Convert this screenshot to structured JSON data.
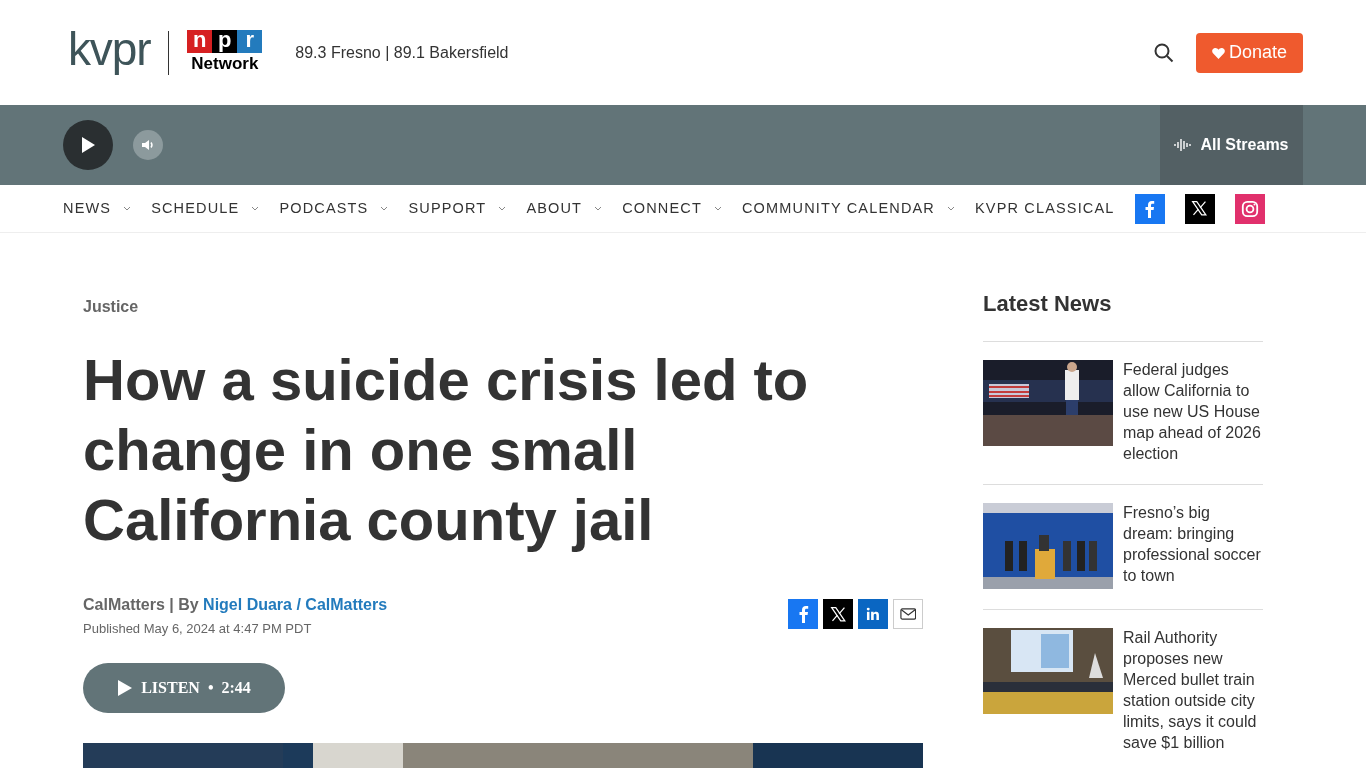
{
  "header": {
    "logo_text": "kvpr",
    "network_logo": {
      "letters": [
        "n",
        "p",
        "r"
      ],
      "caption": "Network"
    },
    "frequencies": "89.3 Fresno | 89.1 Bakersfield",
    "donate": "Donate"
  },
  "player": {
    "streams": "All Streams"
  },
  "nav": [
    {
      "label": "NEWS",
      "has_menu": true
    },
    {
      "label": "SCHEDULE",
      "has_menu": true
    },
    {
      "label": "PODCASTS",
      "has_menu": true
    },
    {
      "label": "SUPPORT",
      "has_menu": true
    },
    {
      "label": "ABOUT",
      "has_menu": true
    },
    {
      "label": "CONNECT",
      "has_menu": true
    },
    {
      "label": "COMMUNITY CALENDAR",
      "has_menu": true
    },
    {
      "label": "KVPR CLASSICAL",
      "has_menu": false
    }
  ],
  "social": [
    {
      "kind": "facebook"
    },
    {
      "kind": "x"
    },
    {
      "kind": "instagram"
    }
  ],
  "article": {
    "section": "Justice",
    "title": "How a suicide crisis led to change in one small California county jail",
    "source": "CalMatters | By",
    "author": "Nigel Duara / CalMatters",
    "published": "Published May 6, 2024 at 4:47 PM PDT",
    "share": [
      {
        "kind": "facebook"
      },
      {
        "kind": "x"
      },
      {
        "kind": "linkedin"
      },
      {
        "kind": "email"
      }
    ],
    "listen": {
      "label": "LISTEN",
      "separator": "•",
      "duration": "2:44"
    }
  },
  "latest_news": {
    "heading": "Latest News",
    "items": [
      {
        "title": "Federal judges allow California to use new US House map ahead of 2026 election"
      },
      {
        "title": "Fresno’s big dream: bringing professional soccer to town"
      },
      {
        "title": "Rail Authority proposes new Merced bullet train station outside city limits, says it could save $1 billion"
      }
    ]
  }
}
